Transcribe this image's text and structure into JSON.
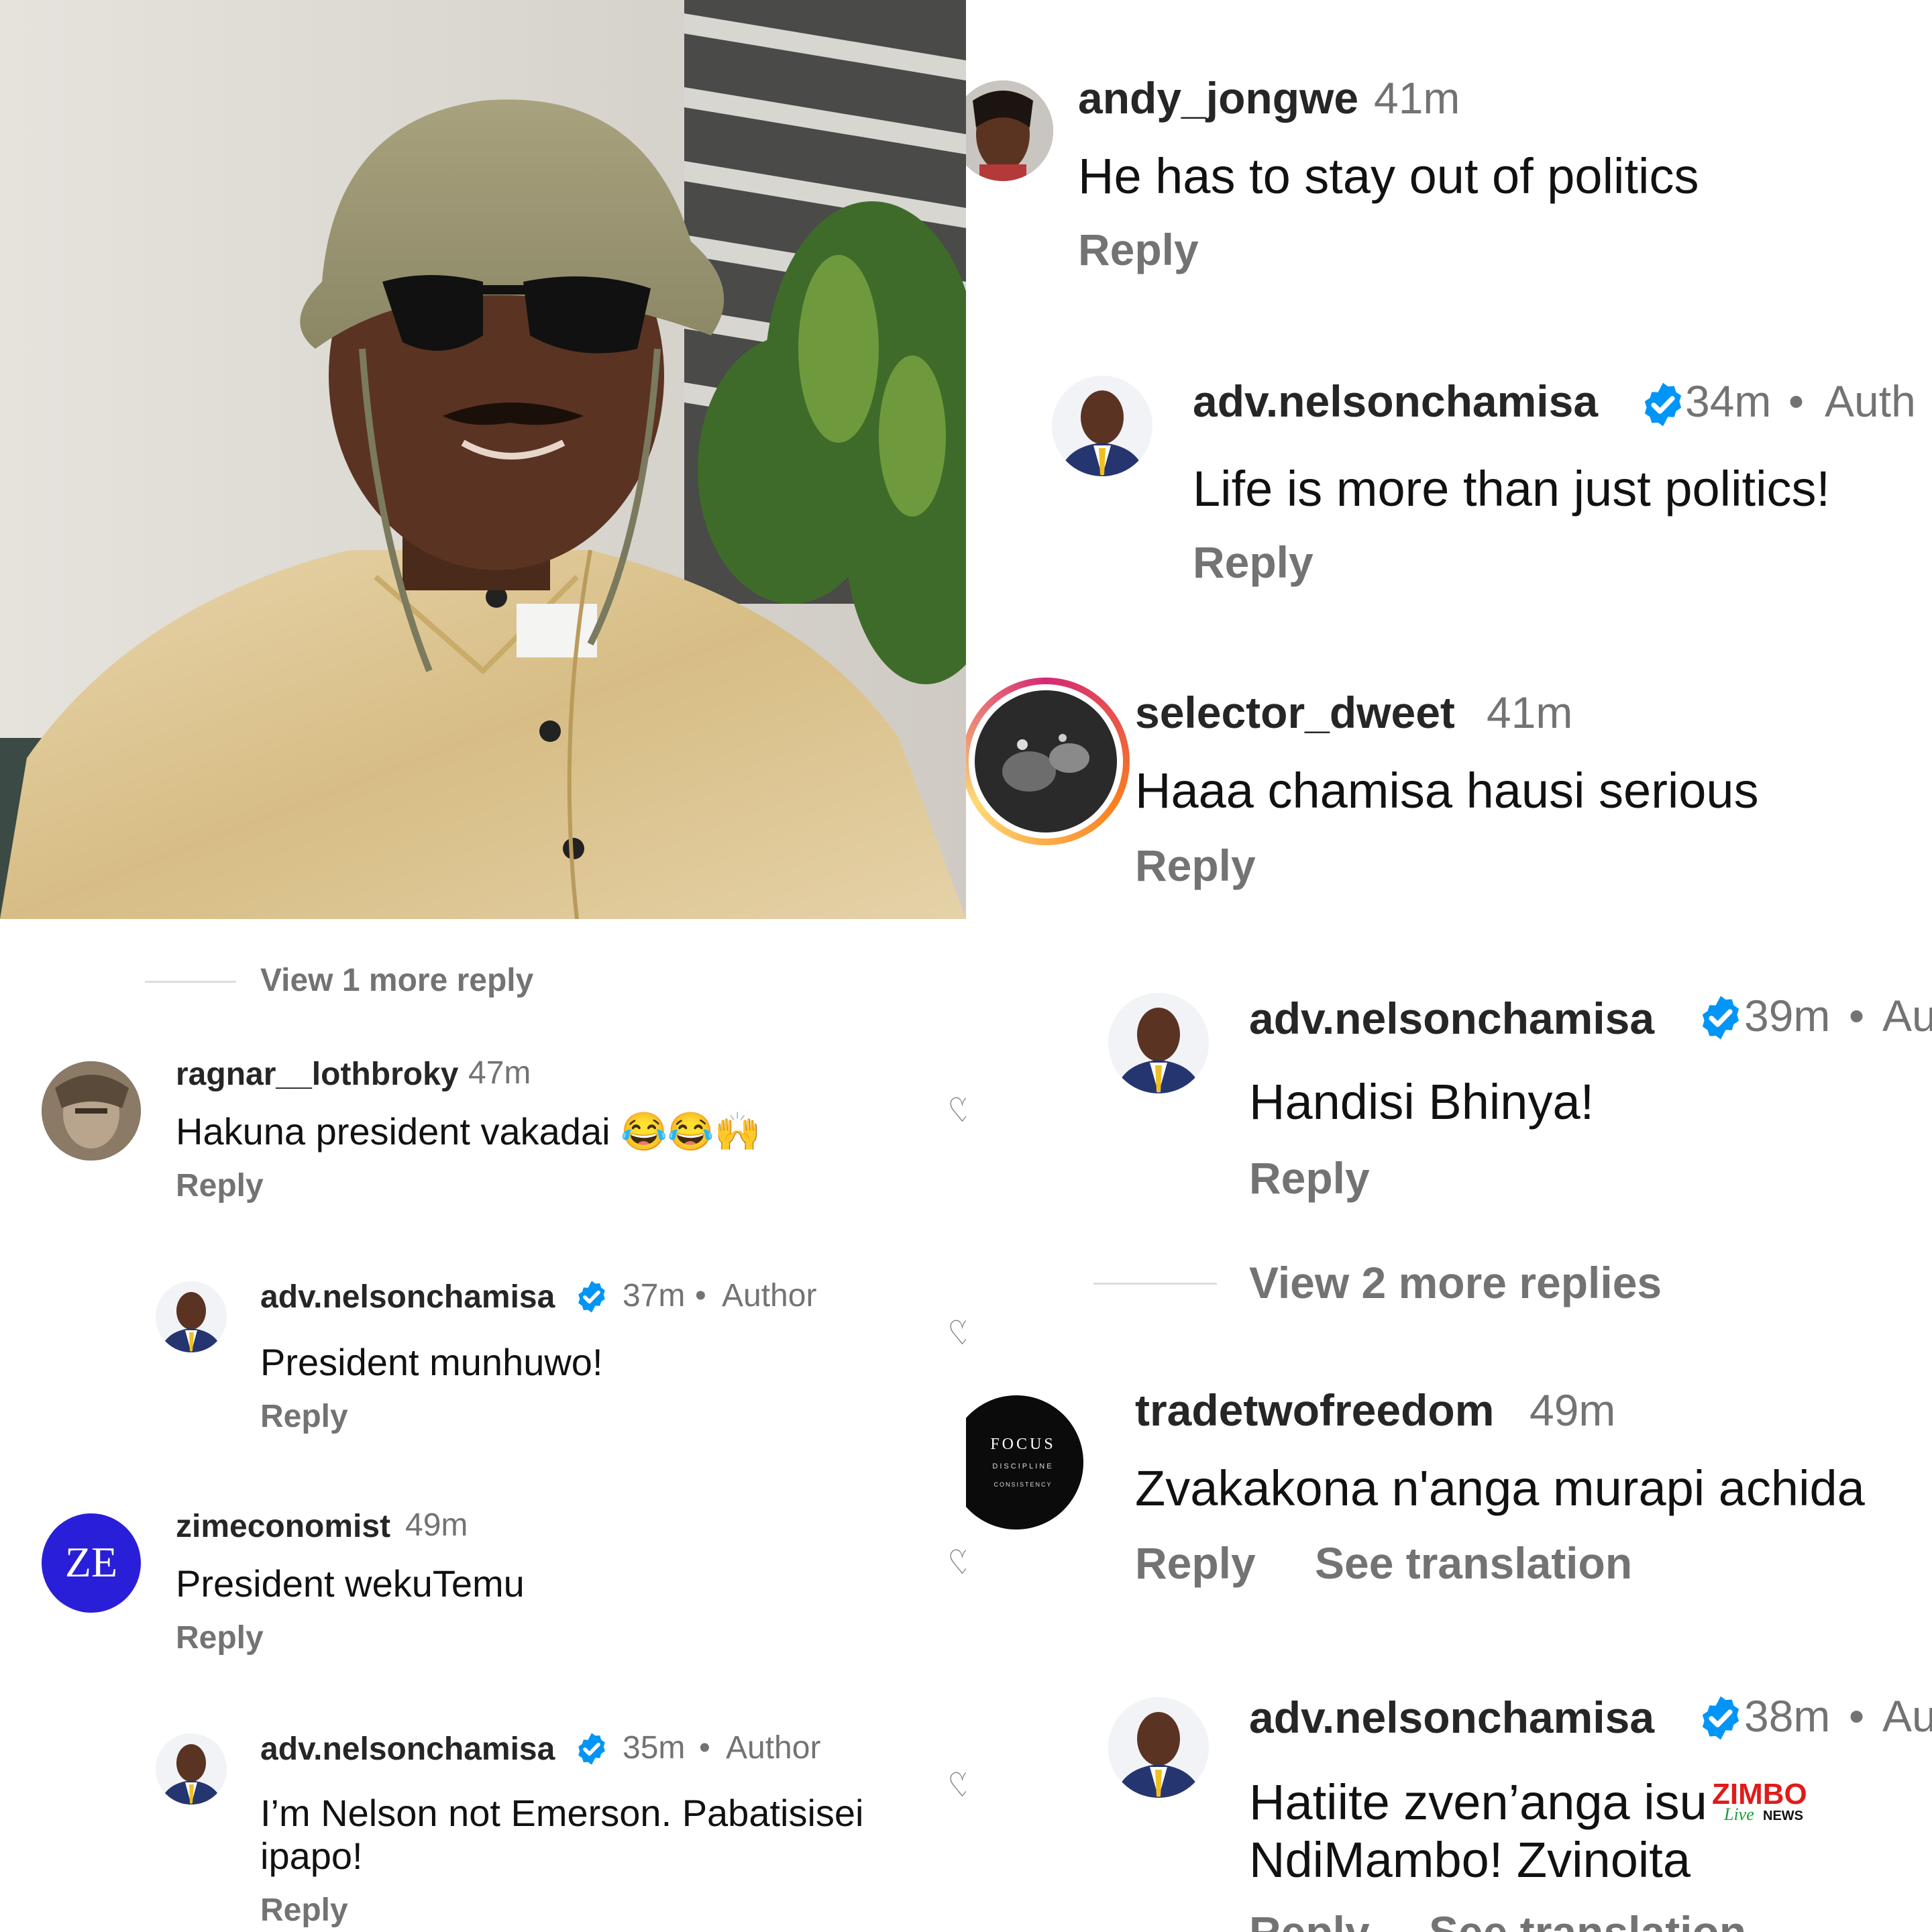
{
  "right_comments": [
    {
      "user": "andy_jongwe",
      "time": "41m",
      "text": "He has to stay out of politics",
      "reply": "Reply"
    },
    {
      "user": "adv.nelsonchamisa",
      "time": "34m",
      "author": "Auth",
      "text": "Life is more than just politics!",
      "reply": "Reply"
    },
    {
      "user": "selector_dweet",
      "time": "41m",
      "text": "Haaa chamisa hausi serious",
      "reply": "Reply"
    },
    {
      "user": "adv.nelsonchamisa",
      "time": "39m",
      "author": "Au",
      "text": "Handisi Bhinya!",
      "reply": "Reply"
    },
    {
      "user": "tradetwofreedom",
      "time": "49m",
      "text": "Zvakakona n'anga murapi achida",
      "reply": "Reply",
      "translate": "See translation",
      "avatar_text": [
        "FOCUS",
        "DISCIPLINE",
        "CONSISTENCY"
      ]
    },
    {
      "user": "adv.nelsonchamisa",
      "time": "38m",
      "author": "Au",
      "text_lines": [
        "Hatiite zven’anga isu",
        "NdiMambo! Zvinoita"
      ],
      "reply": "Reply",
      "translate": "See translation"
    }
  ],
  "right_view_more": "View 2 more replies",
  "left_view_more": "View 1 more reply",
  "left_comments": [
    {
      "user": "ragnar__lothbroky",
      "time": "47m",
      "text": "Hakuna president vakadai 😂😂🙌",
      "reply": "Reply"
    },
    {
      "user": "adv.nelsonchamisa",
      "time": "37m",
      "author": "Author",
      "text": "President munhuwo!",
      "reply": "Reply"
    },
    {
      "user": "zimeconomist",
      "time": "49m",
      "text": "President wekuTemu",
      "reply": "Reply",
      "avatar_text": "ZE"
    },
    {
      "user": "adv.nelsonchamisa",
      "time": "35m",
      "author": "Author",
      "text_lines": [
        "I’m Nelson not Emerson. Pabatisisei",
        "ipapo!"
      ],
      "reply": "Reply"
    }
  ],
  "watermark": {
    "brand": "ZIMBO",
    "sub1": "Live",
    "sub2": "NEWS"
  },
  "colors": {
    "verified": "#0095f6",
    "muted": "#737373",
    "ze_avatar": "#2a1fd8",
    "story_ring_start": "#d62976",
    "story_ring_end": "#fa7e1e"
  }
}
